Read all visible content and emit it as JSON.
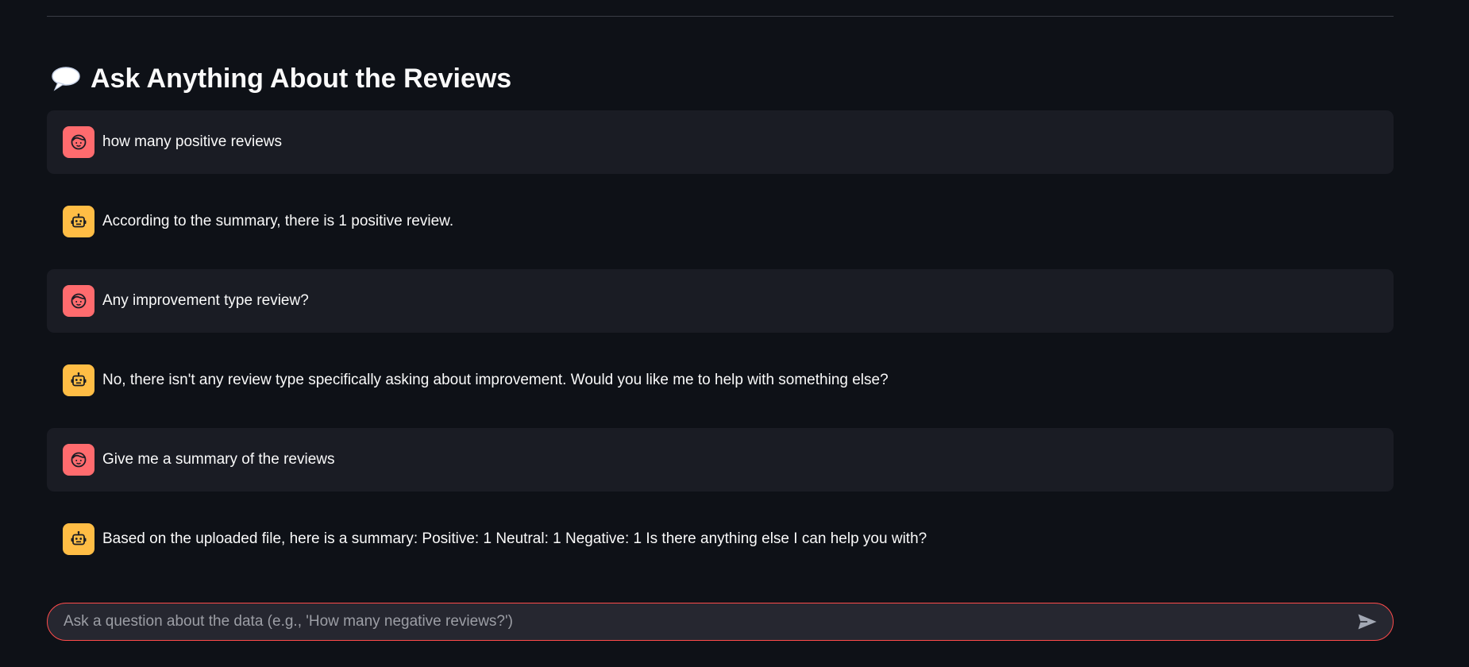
{
  "header": {
    "corner_text": "",
    "title": "Ask Anything About the Reviews",
    "title_icon": "speech-balloon-icon"
  },
  "chat": {
    "messages": [
      {
        "role": "user",
        "avatar_icon": "user-face-icon",
        "text": "how many positive reviews"
      },
      {
        "role": "assistant",
        "avatar_icon": "robot-icon",
        "text": "According to the summary, there is 1 positive review."
      },
      {
        "role": "user",
        "avatar_icon": "user-face-icon",
        "text": "Any improvement type review?"
      },
      {
        "role": "assistant",
        "avatar_icon": "robot-icon",
        "text": "No, there isn't any review type specifically asking about improvement. Would you like me to help with something else?"
      },
      {
        "role": "user",
        "avatar_icon": "user-face-icon",
        "text": "Give me a summary of the reviews"
      },
      {
        "role": "assistant",
        "avatar_icon": "robot-icon",
        "text": "Based on the uploaded file, here is a summary: Positive: 1 Neutral: 1 Negative: 1 Is there anything else I can help you with?"
      }
    ]
  },
  "input": {
    "value": "",
    "placeholder": "Ask a question about the data (e.g., 'How many negative reviews?')",
    "send_icon": "send-arrow-icon"
  },
  "colors": {
    "background": "#0e1117",
    "user_message_bg": "#1a1c24",
    "user_avatar": "#ff6b6e",
    "assistant_avatar": "#ffbd45",
    "input_border": "#ff4b4b",
    "input_bg": "#262730"
  }
}
